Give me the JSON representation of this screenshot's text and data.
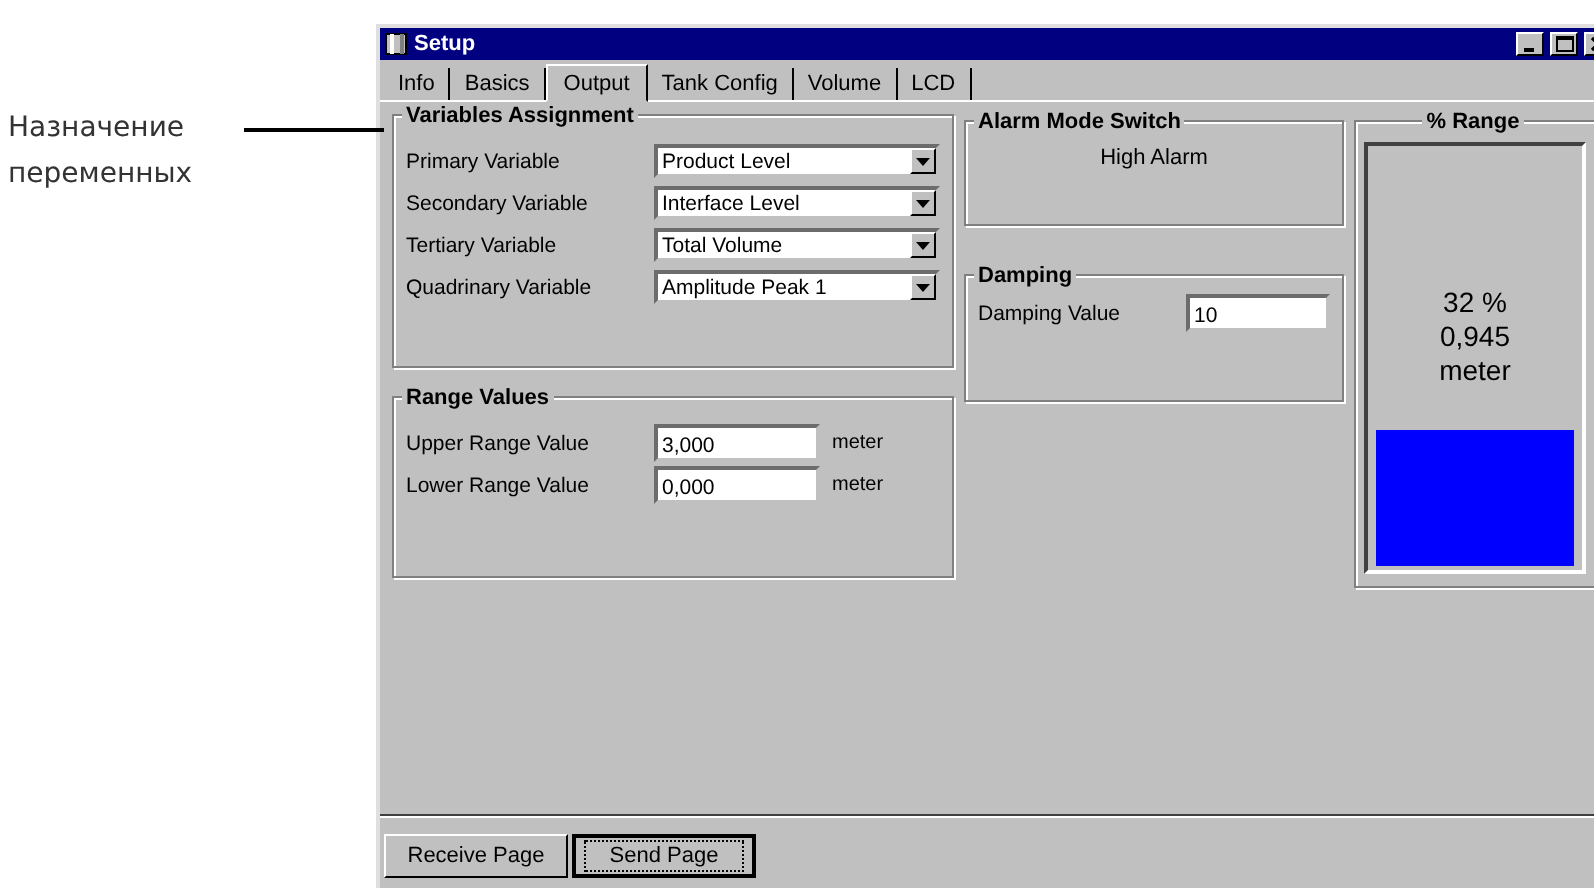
{
  "callout": {
    "text": "Назначение переменных"
  },
  "window": {
    "title": "Setup"
  },
  "tabs": [
    {
      "label": "Info",
      "selected": false
    },
    {
      "label": "Basics",
      "selected": false
    },
    {
      "label": "Output",
      "selected": true
    },
    {
      "label": "Tank Config",
      "selected": false
    },
    {
      "label": "Volume",
      "selected": false
    },
    {
      "label": "LCD",
      "selected": false
    }
  ],
  "variables_assignment": {
    "title": "Variables Assignment",
    "rows": [
      {
        "label": "Primary Variable",
        "value": "Product Level"
      },
      {
        "label": "Secondary Variable",
        "value": "Interface Level"
      },
      {
        "label": "Tertiary Variable",
        "value": "Total Volume"
      },
      {
        "label": "Quadrinary Variable",
        "value": "Amplitude Peak 1"
      }
    ]
  },
  "range_values": {
    "title": "Range Values",
    "rows": [
      {
        "label": "Upper Range Value",
        "value": "3,000",
        "unit": "meter"
      },
      {
        "label": "Lower Range Value",
        "value": "0,000",
        "unit": "meter"
      }
    ]
  },
  "alarm_mode_switch": {
    "title": "Alarm Mode Switch",
    "value": "High Alarm"
  },
  "damping": {
    "title": "Damping",
    "label": "Damping Value",
    "value": "10"
  },
  "range": {
    "title": "% Range",
    "percent": "32 %",
    "reading": "0,945",
    "unit": "meter",
    "level": 0.32
  },
  "buttons": [
    {
      "label": "Receive Page",
      "selected": false
    },
    {
      "label": "Send Page",
      "selected": true
    }
  ]
}
